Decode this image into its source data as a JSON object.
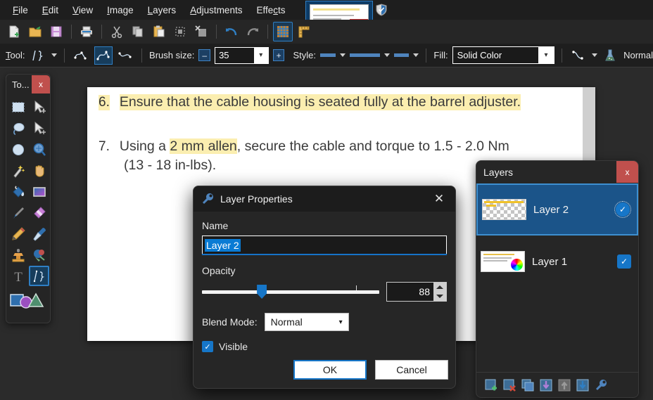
{
  "app": {
    "name": "Paint.NET",
    "accent": "#1676c8",
    "panel_bg": "#262626",
    "toolbar_bg": "#1e1e1e",
    "selection_blue": "#0a7bd4",
    "close_red": "#c0504d"
  },
  "menubar": {
    "items": [
      {
        "label": "File",
        "accel": "F"
      },
      {
        "label": "Edit",
        "accel": "E"
      },
      {
        "label": "View",
        "accel": "V"
      },
      {
        "label": "Image",
        "accel": "I"
      },
      {
        "label": "Layers",
        "accel": "L"
      },
      {
        "label": "Adjustments",
        "accel": "A"
      },
      {
        "label": "Effects",
        "accel": "c"
      }
    ]
  },
  "icon_toolbar": {
    "buttons": [
      {
        "name": "new-image-icon",
        "title": "New"
      },
      {
        "name": "open-image-icon",
        "title": "Open"
      },
      {
        "name": "save-icon",
        "title": "Save"
      },
      {
        "name": "print-icon",
        "title": "Print"
      },
      {
        "name": "cut-icon",
        "title": "Cut"
      },
      {
        "name": "copy-icon",
        "title": "Copy"
      },
      {
        "name": "paste-icon",
        "title": "Paste"
      },
      {
        "name": "crop-to-selection-icon",
        "title": "Crop to Selection"
      },
      {
        "name": "deselect-all-icon",
        "title": "Deselect All"
      },
      {
        "name": "undo-icon",
        "title": "Undo"
      },
      {
        "name": "redo-icon",
        "title": "Redo"
      },
      {
        "name": "grid-icon",
        "title": "Pixel Grid",
        "active": true
      },
      {
        "name": "rulers-icon",
        "title": "Rulers"
      }
    ]
  },
  "options_bar": {
    "tool_label": "Tool:",
    "tool_accel": "T",
    "tool_name": "line-curve-tool-icon",
    "mode_icons": [
      "open-curve-icon",
      "spline-curve-icon",
      "bezier-curve-icon"
    ],
    "mode_selected_index": 1,
    "brush_size_label": "Brush size:",
    "brush_size_value": "35",
    "decrement_label": "–",
    "increment_label": "+",
    "style_label": "Style:",
    "fill_label": "Fill:",
    "fill_value": "Solid Color",
    "blending_icon": "flask-icon",
    "blending_value": "Normal"
  },
  "canvas": {
    "document_lines": [
      {
        "number": "6.",
        "text": "Ensure that the cable housing is seated fully at the barrel adjuster.",
        "fully_highlighted": true
      },
      {
        "number": "7.",
        "pre": "Using a ",
        "highlight": "2 mm allen",
        "post": ", secure the cable and torque to 1.5 - 2.0 Nm",
        "fully_highlighted": false
      },
      {
        "number": "",
        "text": "(13 - 18 in-lbs).",
        "fully_highlighted": false
      }
    ],
    "highlight_color": "#fbeeb0"
  },
  "tools_panel": {
    "title": "To...",
    "close_label": "x",
    "tools": [
      {
        "name": "rectangle-select-tool-icon"
      },
      {
        "name": "move-selected-tool-icon"
      },
      {
        "name": "lasso-select-tool-icon"
      },
      {
        "name": "move-selection-tool-icon"
      },
      {
        "name": "ellipse-select-tool-icon"
      },
      {
        "name": "zoom-tool-icon"
      },
      {
        "name": "magic-wand-tool-icon"
      },
      {
        "name": "pan-tool-icon"
      },
      {
        "name": "paint-bucket-tool-icon"
      },
      {
        "name": "gradient-tool-icon"
      },
      {
        "name": "paintbrush-tool-icon"
      },
      {
        "name": "eraser-tool-icon"
      },
      {
        "name": "pencil-tool-icon"
      },
      {
        "name": "color-picker-tool-icon"
      },
      {
        "name": "clone-stamp-tool-icon"
      },
      {
        "name": "recolor-tool-icon"
      },
      {
        "name": "text-tool-icon"
      },
      {
        "name": "line-curve-tool-icon",
        "selected": true
      }
    ],
    "shapes_tool": {
      "name": "shapes-tool-icon"
    }
  },
  "dialog": {
    "title": "Layer Properties",
    "title_icon": "wrench-icon",
    "close_label": "✕",
    "name_label": "Name",
    "name_value": "Layer 2",
    "opacity_label": "Opacity",
    "opacity_value": "88",
    "opacity_percent": 88,
    "blend_mode_label": "Blend Mode:",
    "blend_mode_value": "Normal",
    "visible_label": "Visible",
    "visible_checked": true,
    "ok_label": "OK",
    "cancel_label": "Cancel"
  },
  "layers_panel": {
    "title": "Layers",
    "close_label": "x",
    "layers": [
      {
        "name": "Layer 2",
        "visible": true,
        "selected": true,
        "thumb": "checkerboard-with-yellow-highlights"
      },
      {
        "name": "Layer 1",
        "visible": true,
        "selected": false,
        "thumb": "document-page-with-color-wheel"
      }
    ],
    "toolbar_buttons": [
      {
        "name": "add-new-layer-icon"
      },
      {
        "name": "delete-layer-icon"
      },
      {
        "name": "duplicate-layer-icon"
      },
      {
        "name": "merge-layer-down-icon"
      },
      {
        "name": "move-layer-up-icon",
        "disabled": true
      },
      {
        "name": "move-layer-down-icon"
      },
      {
        "name": "layer-properties-icon"
      }
    ]
  }
}
